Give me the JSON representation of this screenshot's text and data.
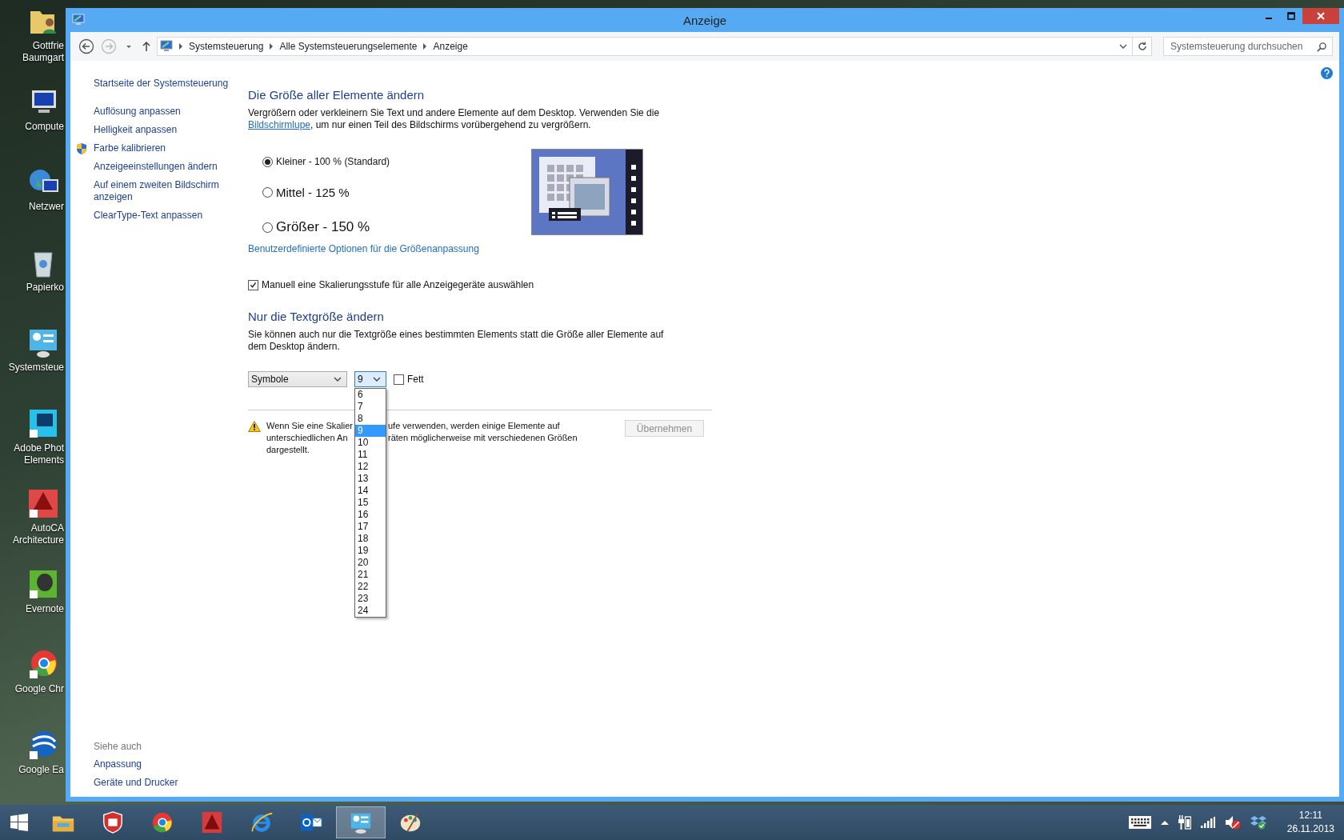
{
  "desktop_icons": [
    {
      "kind": "user-folder",
      "lines": [
        "Gottfrie",
        "Baumgart"
      ]
    },
    {
      "kind": "computer",
      "lines": [
        "Compute"
      ]
    },
    {
      "kind": "network",
      "lines": [
        "Netzwer"
      ]
    },
    {
      "kind": "recycle",
      "lines": [
        "Papierko"
      ]
    },
    {
      "kind": "control-panel",
      "lines": [
        "Systemsteue"
      ]
    },
    {
      "kind": "photo",
      "lines": [
        "Adobe Phot",
        "Elements"
      ]
    },
    {
      "kind": "autocad",
      "lines": [
        "AutoCA",
        "Architecture"
      ]
    },
    {
      "kind": "evernote",
      "lines": [
        "Evernote"
      ]
    },
    {
      "kind": "chrome",
      "lines": [
        "Google Chr"
      ]
    },
    {
      "kind": "earth",
      "lines": [
        "Google Ea"
      ]
    }
  ],
  "window": {
    "title": "Anzeige"
  },
  "address_bar": {
    "breadcrumbs": [
      "Systemsteuerung",
      "Alle Systemsteuerungselemente",
      "Anzeige"
    ]
  },
  "search": {
    "placeholder": "Systemsteuerung durchsuchen"
  },
  "sidebar": {
    "items": [
      {
        "label": "Startseite der Systemsteuerung",
        "kind": "home"
      },
      {
        "label": "Auflösung anpassen",
        "kind": "link"
      },
      {
        "label": "Helligkeit anpassen",
        "kind": "link"
      },
      {
        "label": "Farbe kalibrieren",
        "kind": "shield"
      },
      {
        "label": "Anzeigeeinstellungen ändern",
        "kind": "link"
      },
      {
        "label": "Auf einem zweiten Bildschirm anzeigen",
        "kind": "link"
      },
      {
        "label": "ClearType-Text anpassen",
        "kind": "link"
      }
    ],
    "see_also": {
      "title": "Siehe auch",
      "items": [
        "Anpassung",
        "Geräte und Drucker"
      ]
    }
  },
  "size_section": {
    "heading": "Die Größe aller Elemente ändern",
    "description_before": "Vergrößern oder verkleinern Sie Text und andere Elemente auf dem Desktop. Verwenden Sie die",
    "description_link": "Bildschirmlupe",
    "description_after": ", um nur einen Teil des Bildschirms vorübergehend zu vergrößern.",
    "options": [
      {
        "label": "Kleiner - 100 % (Standard)",
        "kind": "small",
        "selected": true
      },
      {
        "label": "Mittel - 125 %",
        "kind": "medium",
        "selected": false
      },
      {
        "label": "Größer - 150 %",
        "kind": "large",
        "selected": false
      }
    ],
    "custom_link": "Benutzerdefinierte Optionen für die Größenanpassung",
    "scaling_checkbox": {
      "label": "Manuell eine Skalierungsstufe für alle Anzeigegeräte auswählen",
      "checked": true
    }
  },
  "text_section": {
    "heading": "Nur die Textgröße ändern",
    "description": "Sie können auch nur die Textgröße eines bestimmten Elements statt die Größe aller Elemente auf dem Desktop ändern.",
    "element_select": {
      "value": "Symbole"
    },
    "size_select": {
      "value": "9",
      "expanded": true,
      "options": [
        {
          "label": "6",
          "selected": false
        },
        {
          "label": "7",
          "selected": false
        },
        {
          "label": "8",
          "selected": false
        },
        {
          "label": "9",
          "selected": true
        },
        {
          "label": "10",
          "selected": false
        },
        {
          "label": "11",
          "selected": false
        },
        {
          "label": "12",
          "selected": false
        },
        {
          "label": "13",
          "selected": false
        },
        {
          "label": "14",
          "selected": false
        },
        {
          "label": "15",
          "selected": false
        },
        {
          "label": "16",
          "selected": false
        },
        {
          "label": "17",
          "selected": false
        },
        {
          "label": "18",
          "selected": false
        },
        {
          "label": "19",
          "selected": false
        },
        {
          "label": "20",
          "selected": false
        },
        {
          "label": "21",
          "selected": false
        },
        {
          "label": "22",
          "selected": false
        },
        {
          "label": "23",
          "selected": false
        },
        {
          "label": "24",
          "selected": false
        }
      ]
    },
    "bold_checkbox": {
      "label": "Fett",
      "checked": false
    }
  },
  "warning": {
    "lines": [
      [
        "Wenn Sie eine Skalier",
        "ufe verwenden, werden einige Elemente auf"
      ],
      [
        "unterschiedlichen An",
        "räten möglicherweise mit verschiedenen Größen"
      ],
      [
        "dargestellt."
      ]
    ]
  },
  "apply_button": {
    "label": "Übernehmen",
    "disabled": true
  },
  "taskbar": {
    "apps": [
      {
        "kind": "explorer",
        "selected": false
      },
      {
        "kind": "shield",
        "selected": false
      },
      {
        "kind": "chrome",
        "selected": false
      },
      {
        "kind": "autocad",
        "selected": false
      },
      {
        "kind": "ie",
        "selected": false
      },
      {
        "kind": "outlook",
        "selected": false
      },
      {
        "kind": "control-panel",
        "selected": true
      },
      {
        "kind": "paint",
        "selected": false
      }
    ],
    "time": "12:11",
    "date": "26.11.2013"
  }
}
